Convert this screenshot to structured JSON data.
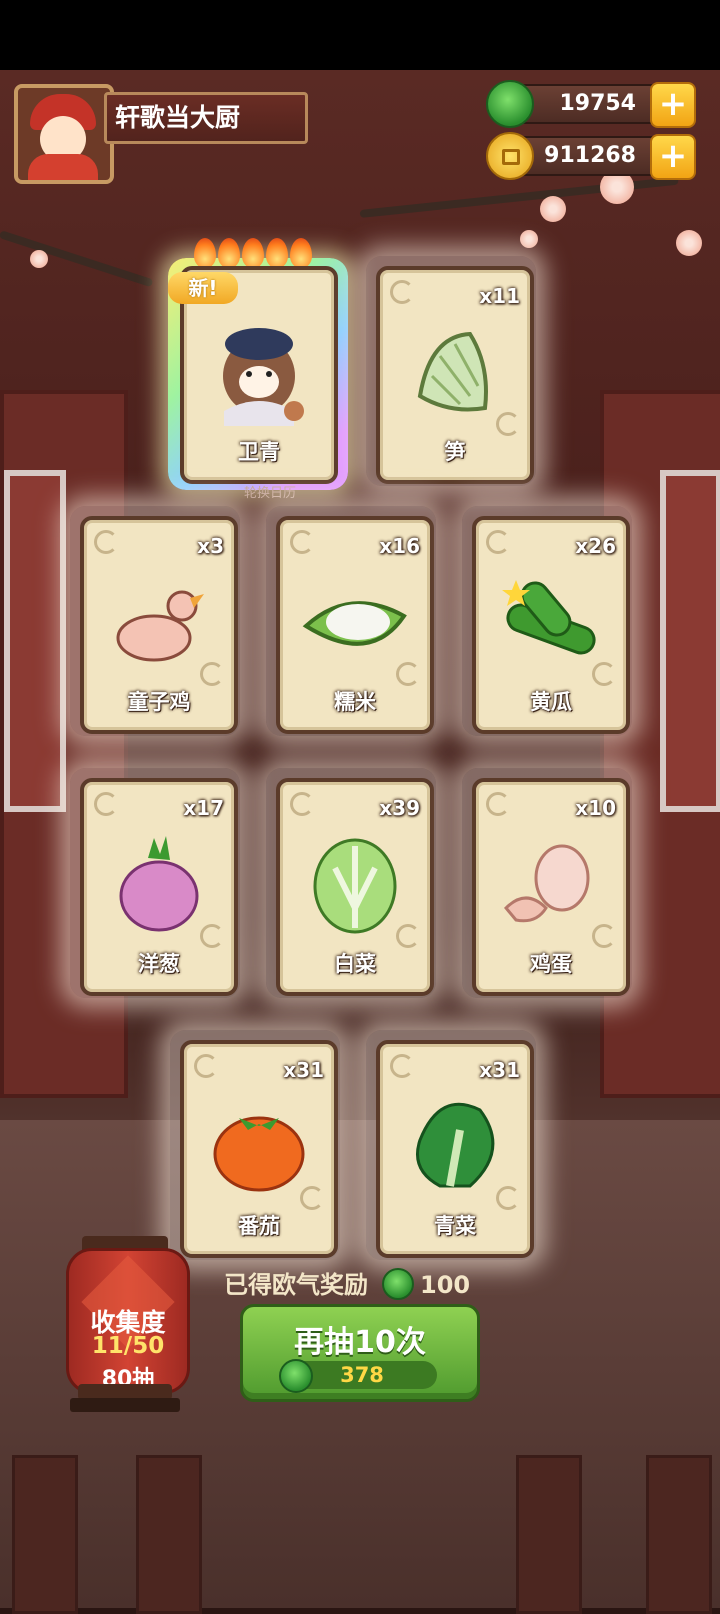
{
  "header": {
    "player_name": "轩歌当大厨",
    "jade_amount": "19754",
    "coin_amount": "911268"
  },
  "featured": {
    "badge": "新!",
    "name": "卫青",
    "stars": 5,
    "calendar_hint": "轮换日历"
  },
  "cards": [
    {
      "name": "笋",
      "qty": "x11"
    },
    {
      "name": "童子鸡",
      "qty": "x3"
    },
    {
      "name": "糯米",
      "qty": "x16"
    },
    {
      "name": "黄瓜",
      "qty": "x26"
    },
    {
      "name": "洋葱",
      "qty": "x17"
    },
    {
      "name": "白菜",
      "qty": "x39"
    },
    {
      "name": "鸡蛋",
      "qty": "x10"
    },
    {
      "name": "番茄",
      "qty": "x31"
    },
    {
      "name": "青菜",
      "qty": "x31"
    }
  ],
  "collection": {
    "title": "收集度",
    "progress": "11/50",
    "draws": "80抽"
  },
  "reward": {
    "label": "已得欧气奖励",
    "amount": "100"
  },
  "draw_button": {
    "label": "再抽10次",
    "cost": "378"
  },
  "colors": {
    "jade": "#2a8f2e",
    "gold": "#f2a414",
    "card_bg": "#f2e5c2",
    "button_green": "#4f9a2e"
  }
}
